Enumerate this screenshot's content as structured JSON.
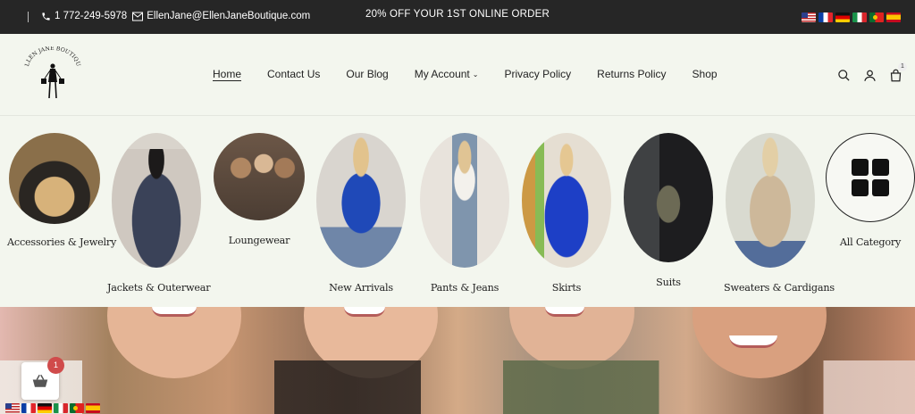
{
  "topbar": {
    "phone": "1 772-249-5978",
    "email": "EllenJane@EllenJaneBoutique.com",
    "promo": "20% OFF YOUR 1ST ONLINE ORDER",
    "flags": [
      "us-flag-icon",
      "fr-flag-icon",
      "de-flag-icon",
      "it-flag-icon",
      "pt-flag-icon",
      "es-flag-icon"
    ]
  },
  "header": {
    "logo_text": "ELLEN JANE BOUTIQUE",
    "nav": [
      "Home",
      "Contact Us",
      "Our Blog",
      "My Account",
      "Privacy Policy",
      "Returns Policy",
      "Shop"
    ],
    "cart_count": "1"
  },
  "categories": [
    {
      "label": "Accessories & Jewelry"
    },
    {
      "label": "Jackets & Outerwear"
    },
    {
      "label": "Loungewear"
    },
    {
      "label": "New Arrivals"
    },
    {
      "label": "Pants & Jeans"
    },
    {
      "label": "Skirts"
    },
    {
      "label": "Suits"
    },
    {
      "label": "Sweaters & Cardigans"
    },
    {
      "label": "All Category"
    }
  ],
  "floating_cart": {
    "count": "1"
  },
  "colors": {
    "topbar": "#262626",
    "background": "#f3f6ee",
    "badge": "#d04b4b"
  }
}
